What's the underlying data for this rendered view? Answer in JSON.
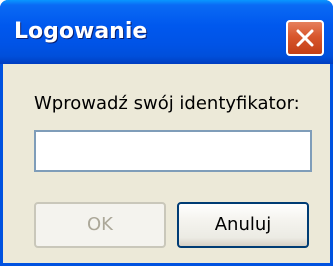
{
  "window": {
    "title": "Logowanie"
  },
  "title_bar": {
    "close_icon": "close-x-icon"
  },
  "form": {
    "prompt_label": "Wprowadź swój identyfikator:",
    "id_field": {
      "value": "",
      "placeholder": ""
    }
  },
  "buttons": {
    "ok_label": "OK",
    "ok_enabled": false,
    "cancel_label": "Anuluj"
  },
  "colors": {
    "titlebar_blue": "#0058EE",
    "close_red": "#D8572D",
    "dialog_bg": "#ECE9D8",
    "disabled_text": "#ACA899"
  }
}
